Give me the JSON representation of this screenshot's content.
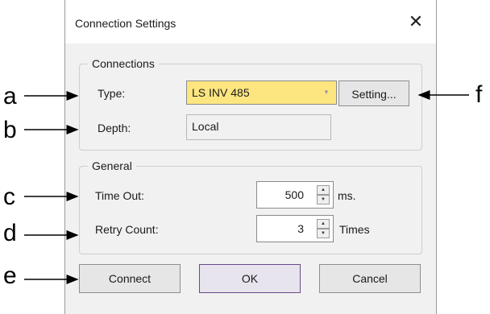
{
  "dialog": {
    "title": "Connection Settings",
    "close_glyph": "✕"
  },
  "connections": {
    "group_title": "Connections",
    "type_label": "Type:",
    "type_value": "LS INV 485",
    "type_dropdown_icon": "chevron-down-icon",
    "setting_button": "Setting...",
    "depth_label": "Depth:",
    "depth_value": "Local"
  },
  "general": {
    "group_title": "General",
    "timeout_label": "Time Out:",
    "timeout_value": "500",
    "timeout_unit": "ms.",
    "retry_label": "Retry Count:",
    "retry_value": "3",
    "retry_unit": "Times"
  },
  "buttons": {
    "connect": "Connect",
    "ok": "OK",
    "cancel": "Cancel"
  },
  "callouts": {
    "a": "a",
    "b": "b",
    "c": "c",
    "d": "d",
    "e": "e",
    "f": "f"
  },
  "colors": {
    "combo_highlight": "#fde680",
    "ok_border": "#6a4a8c",
    "dialog_bg": "#f1f1f1"
  }
}
